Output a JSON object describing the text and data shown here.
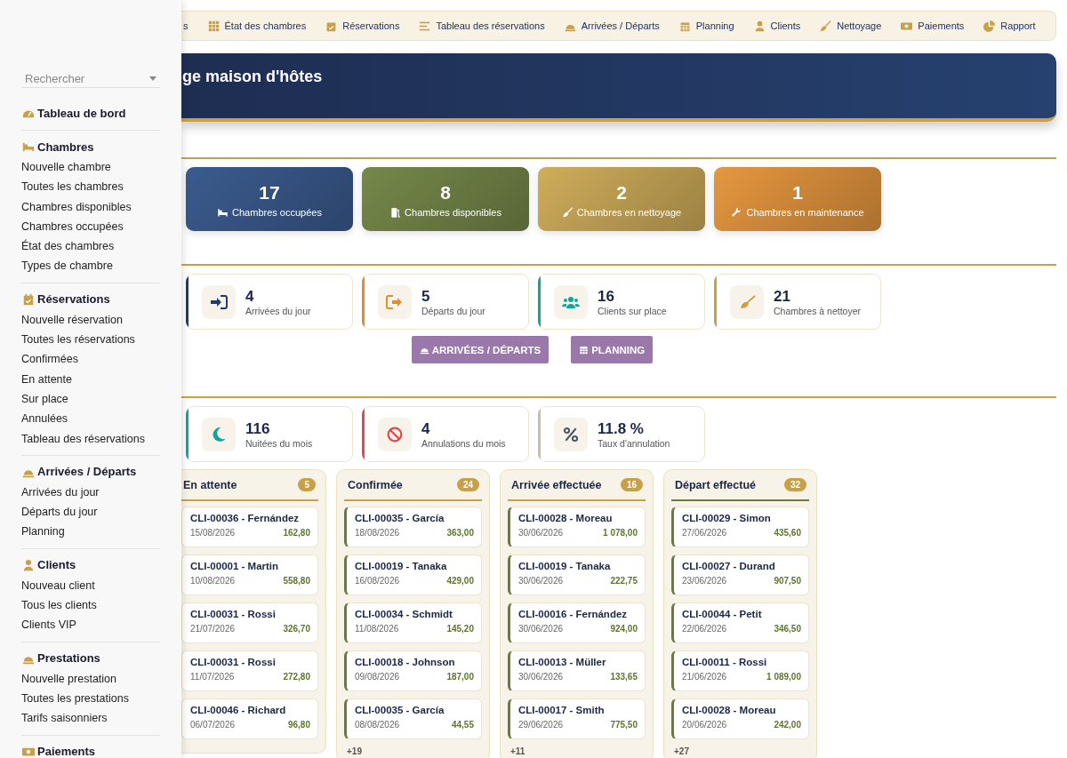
{
  "sidebar": {
    "search": {
      "placeholder": "Rechercher"
    },
    "sections": [
      {
        "title": "Tableau de bord"
      },
      {
        "title": "Chambres",
        "items": [
          "Nouvelle chambre",
          "Toutes les chambres",
          "Chambres disponibles",
          "Chambres occupées",
          "État des chambres",
          "Types de chambre"
        ]
      },
      {
        "title": "Réservations",
        "items": [
          "Nouvelle réservation",
          "Toutes les réservations",
          "Confirmées",
          "En attente",
          "Sur place",
          "Annulées",
          "Tableau des réservations"
        ]
      },
      {
        "title": "Arrivées / Départs",
        "items": [
          "Arrivées du jour",
          "Départs du jour",
          "Planning"
        ]
      },
      {
        "title": "Clients",
        "items": [
          "Nouveau client",
          "Tous les clients",
          "Clients VIP"
        ]
      },
      {
        "title": "Prestations",
        "items": [
          "Nouvelle prestation",
          "Toutes les prestations",
          "Tarifs saisonniers"
        ]
      },
      {
        "title": "Paiements"
      }
    ]
  },
  "top_nav": [
    "s",
    "État des chambres",
    "Réservations",
    "Tableau des réservations",
    "Arrivées / Départs",
    "Planning",
    "Clients",
    "Nettoyage",
    "Paiements",
    "Rapport"
  ],
  "banner": {
    "title": "ge maison d'hôtes"
  },
  "room_stats": [
    {
      "value": "17",
      "label": "Chambres occupées",
      "color": "#3b5b8f"
    },
    {
      "value": "8",
      "label": "Chambres disponibles",
      "color": "#76884a"
    },
    {
      "value": "2",
      "label": "Chambres en nettoyage",
      "color": "#cfad5a"
    },
    {
      "value": "1",
      "label": "Chambres en maintenance",
      "color": "#e6973f"
    }
  ],
  "day_stats": [
    {
      "value": "4",
      "label": "Arrivées du jour",
      "color": "#1f3a6b"
    },
    {
      "value": "5",
      "label": "Départs du jour",
      "color": "#e08e2c"
    },
    {
      "value": "16",
      "label": "Clients sur place",
      "color": "#14a39a"
    },
    {
      "value": "21",
      "label": "Chambres à nettoyer",
      "color": "#c9a04a"
    }
  ],
  "action_buttons": [
    "ARRIVÉES / DÉPARTS",
    "PLANNING"
  ],
  "month_stats": [
    {
      "value": "116",
      "label": "Nuitées du mois",
      "color": "#14a39a"
    },
    {
      "value": "4",
      "label": "Annulations du mois",
      "color": "#dc4c4c"
    },
    {
      "value": "11.8 %",
      "label": "Taux d'annulation",
      "color": "#c8bfa0"
    }
  ],
  "kanban": [
    {
      "title": "En attente",
      "count": "5",
      "color": "#c9a04a",
      "cards": [
        {
          "client": "CLI-00036 - Fernández",
          "date": "15/08/2026",
          "amount": "162,80"
        },
        {
          "client": "CLI-00001 - Martin",
          "date": "10/08/2026",
          "amount": "558,80"
        },
        {
          "client": "CLI-00031 - Rossi",
          "date": "21/07/2026",
          "amount": "326,70"
        },
        {
          "client": "CLI-00031 - Rossi",
          "date": "11/07/2026",
          "amount": "272,80"
        },
        {
          "client": "CLI-00046 - Richard",
          "date": "06/07/2026",
          "amount": "96,80"
        }
      ]
    },
    {
      "title": "Confirmée",
      "count": "24",
      "color": "#c9a04a",
      "more": "+19",
      "cards": [
        {
          "client": "CLI-00035 - García",
          "date": "18/08/2026",
          "amount": "363,00"
        },
        {
          "client": "CLI-00019 - Tanaka",
          "date": "16/08/2026",
          "amount": "429,00"
        },
        {
          "client": "CLI-00034 - Schmidt",
          "date": "11/08/2026",
          "amount": "145,20"
        },
        {
          "client": "CLI-00018 - Johnson",
          "date": "09/08/2026",
          "amount": "187,00"
        },
        {
          "client": "CLI-00035 - García",
          "date": "08/08/2026",
          "amount": "44,55"
        }
      ]
    },
    {
      "title": "Arrivée effectuée",
      "count": "16",
      "color": "#c9a04a",
      "more": "+11",
      "cards": [
        {
          "client": "CLI-00028 - Moreau",
          "date": "30/06/2026",
          "amount": "1 078,00"
        },
        {
          "client": "CLI-00019 - Tanaka",
          "date": "30/06/2026",
          "amount": "222,75"
        },
        {
          "client": "CLI-00016 - Fernández",
          "date": "30/06/2026",
          "amount": "924,00"
        },
        {
          "client": "CLI-00013 - Müller",
          "date": "30/06/2026",
          "amount": "133,65"
        },
        {
          "client": "CLI-00017 - Smith",
          "date": "29/06/2026",
          "amount": "775,50"
        }
      ]
    },
    {
      "title": "Départ effectué",
      "count": "32",
      "color": "#6b7a3a",
      "more": "+27",
      "cards": [
        {
          "client": "CLI-00029 - Simon",
          "date": "27/06/2026",
          "amount": "435,60"
        },
        {
          "client": "CLI-00027 - Durand",
          "date": "23/06/2026",
          "amount": "907,50"
        },
        {
          "client": "CLI-00044 - Petit",
          "date": "22/06/2026",
          "amount": "346,50"
        },
        {
          "client": "CLI-00011 - Rossi",
          "date": "21/06/2026",
          "amount": "1 089,00"
        },
        {
          "client": "CLI-00028 - Moreau",
          "date": "20/06/2026",
          "amount": "242,00"
        }
      ]
    }
  ]
}
